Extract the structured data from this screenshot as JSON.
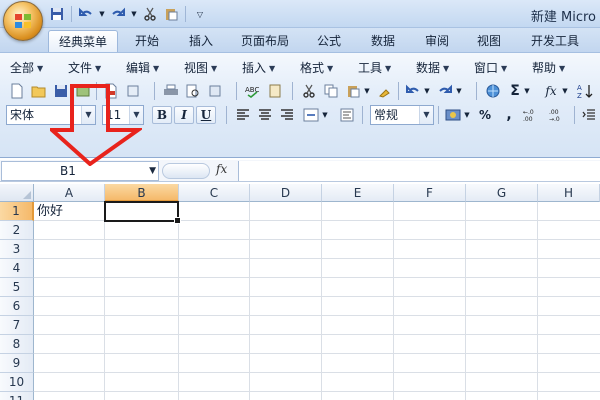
{
  "window": {
    "title": "新建 Micro"
  },
  "tabs": [
    {
      "label": "经典菜单",
      "active": true
    },
    {
      "label": "开始"
    },
    {
      "label": "插入"
    },
    {
      "label": "页面布局"
    },
    {
      "label": "公式"
    },
    {
      "label": "数据"
    },
    {
      "label": "审阅"
    },
    {
      "label": "视图"
    },
    {
      "label": "开发工具"
    }
  ],
  "menu": [
    {
      "label": "全部"
    },
    {
      "label": "文件"
    },
    {
      "label": "编辑"
    },
    {
      "label": "视图"
    },
    {
      "label": "插入"
    },
    {
      "label": "格式"
    },
    {
      "label": "工具"
    },
    {
      "label": "数据"
    },
    {
      "label": "窗口"
    },
    {
      "label": "帮助"
    }
  ],
  "format": {
    "font_name": "宋体",
    "font_size": "11",
    "bold": "B",
    "italic": "I",
    "underline": "U",
    "number_format": "常规",
    "percent": "%",
    "comma": ",",
    "inc_decimal": "+.0\n.00",
    "dec_decimal": ".00\n+.0",
    "sigma": "Σ",
    "fx_icon": "fx"
  },
  "formula_bar": {
    "name_box": "B1",
    "fx_label": "fx",
    "value": ""
  },
  "grid": {
    "columns": [
      "A",
      "B",
      "C",
      "D",
      "E",
      "F",
      "G",
      "H"
    ],
    "rows": [
      "1",
      "2",
      "3",
      "4",
      "5",
      "6",
      "7",
      "8",
      "9",
      "10",
      "11"
    ],
    "selected_column": "B",
    "selected_row": "1",
    "cells": {
      "A1": "你好"
    }
  },
  "colors": {
    "accent_selection": "#f5b96a",
    "arrow": "#e8231c"
  }
}
